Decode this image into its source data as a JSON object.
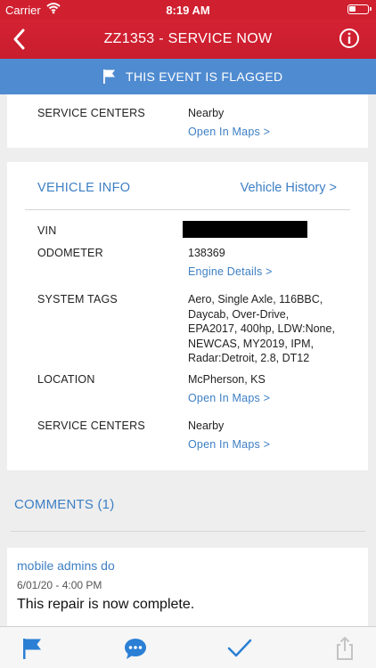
{
  "status_bar": {
    "carrier": "Carrier",
    "time": "8:19 AM"
  },
  "nav": {
    "title": "ZZ1353 - SERVICE NOW"
  },
  "flag_banner": {
    "text": "THIS EVENT IS FLAGGED"
  },
  "top_card": {
    "service_centers_label": "SERVICE CENTERS",
    "service_centers_value": "Nearby",
    "open_in_maps": "Open In Maps >"
  },
  "vehicle_info": {
    "title": "VEHICLE INFO",
    "history_link": "Vehicle History >",
    "vin_label": "VIN",
    "odometer_label": "ODOMETER",
    "odometer_value": "138369",
    "engine_details_link": "Engine Details >",
    "system_tags_label": "SYSTEM TAGS",
    "system_tags_lines": [
      "Aero, Single Axle, 116BBC,",
      "Daycab, Over-Drive,",
      "EPA2017, 400hp, LDW:None,",
      "NEWCAS, MY2019, IPM,",
      "Radar:Detroit, 2.8, DT12"
    ],
    "location_label": "LOCATION",
    "location_value": "McPherson, KS",
    "location_maps_link": "Open In Maps >",
    "service_centers_label": "SERVICE CENTERS",
    "service_centers_value": "Nearby",
    "service_maps_link": "Open In Maps >"
  },
  "comments": {
    "header": "COMMENTS (1)",
    "items": [
      {
        "author": "mobile admins do",
        "date": "6/01/20 - 4:00 PM",
        "text": "This repair is now complete."
      }
    ]
  },
  "colors": {
    "nav_red": "#c81d2d",
    "flag_blue": "#4f8bd0",
    "link_blue": "#3d7fc4",
    "tab_active_blue": "#2b7fd4",
    "tab_disabled_gray": "#c4c4c4"
  },
  "tab_bar": {
    "items": [
      {
        "icon": "flag-icon",
        "state": "active"
      },
      {
        "icon": "comment-icon",
        "state": "active"
      },
      {
        "icon": "checkmark-icon",
        "state": "active"
      },
      {
        "icon": "share-icon",
        "state": "disabled"
      }
    ]
  }
}
